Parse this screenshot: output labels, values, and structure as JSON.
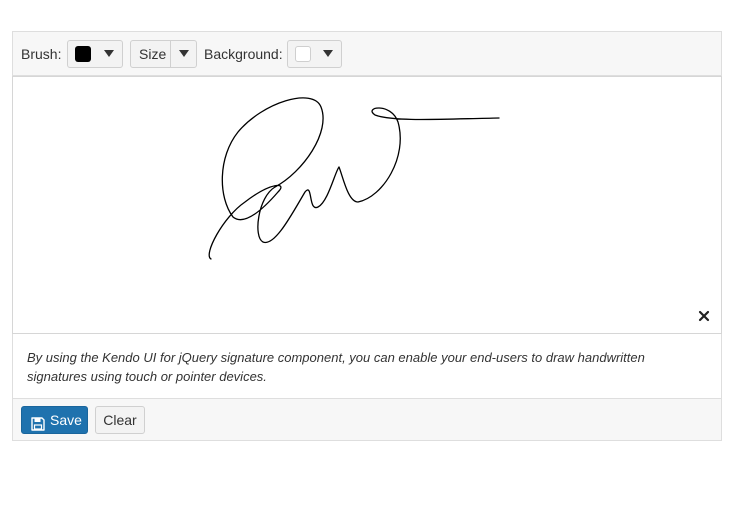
{
  "toolbar": {
    "brush_label": "Brush:",
    "brush_color": "#000000",
    "size_value": "Size",
    "background_label": "Background:",
    "background_color": "#ffffff"
  },
  "canvas": {
    "stroke_color": "#000000",
    "clear_icon": "close-icon"
  },
  "description": "By using the Kendo UI for jQuery signature component, you can enable your end-users to draw handwritten signatures using touch or pointer devices.",
  "footer": {
    "save_label": "Save",
    "save_icon": "floppy-disk-icon",
    "clear_label": "Clear",
    "accent_color": "#1f72ae"
  }
}
